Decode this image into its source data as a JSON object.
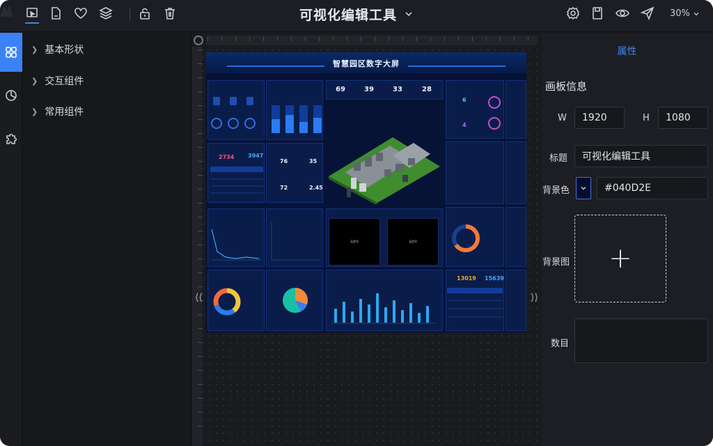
{
  "window": {
    "title": "可视化编辑工具"
  },
  "toolbar": {
    "left_icons": [
      "preview-frame-icon",
      "file-icon",
      "heart-icon",
      "layers-icon",
      "unlock-icon",
      "trash-icon"
    ],
    "right_icons": [
      "gear-icon",
      "save-icon",
      "eye-icon",
      "send-icon"
    ],
    "zoom": "30%"
  },
  "rail": {
    "items": [
      {
        "icon": "grid-icon",
        "active": true
      },
      {
        "icon": "chart-pie-icon",
        "active": false
      },
      {
        "icon": "puzzle-icon",
        "active": false
      }
    ]
  },
  "components": {
    "groups": [
      "基本形状",
      "交互组件",
      "常用组件"
    ]
  },
  "preview": {
    "title": "智慧园区数字大屏",
    "stats": [
      "69",
      "39",
      "33",
      "28"
    ],
    "metrics": {
      "a": "2734",
      "b": "3947",
      "c": "76",
      "d": "35",
      "e": "72",
      "f": "2.45",
      "g": "13019",
      "h": "15639",
      "temp1": "6",
      "temp2": "4"
    },
    "video_labels": [
      "无信号",
      "无信号"
    ],
    "accent": "#1f6fe0"
  },
  "properties": {
    "tab": "属性",
    "section": "画板信息",
    "width_label": "W",
    "width_value": "1920",
    "height_label": "H",
    "height_value": "1080",
    "title_label": "标题",
    "title_value": "可视化编辑工具",
    "bg_color_label": "背景色",
    "bg_color_value": "#040D2E",
    "bg_image_label": "背景图",
    "count_label": "数目"
  },
  "colors": {
    "accent": "#3b82f6",
    "canvas_bg": "#040D2E"
  }
}
